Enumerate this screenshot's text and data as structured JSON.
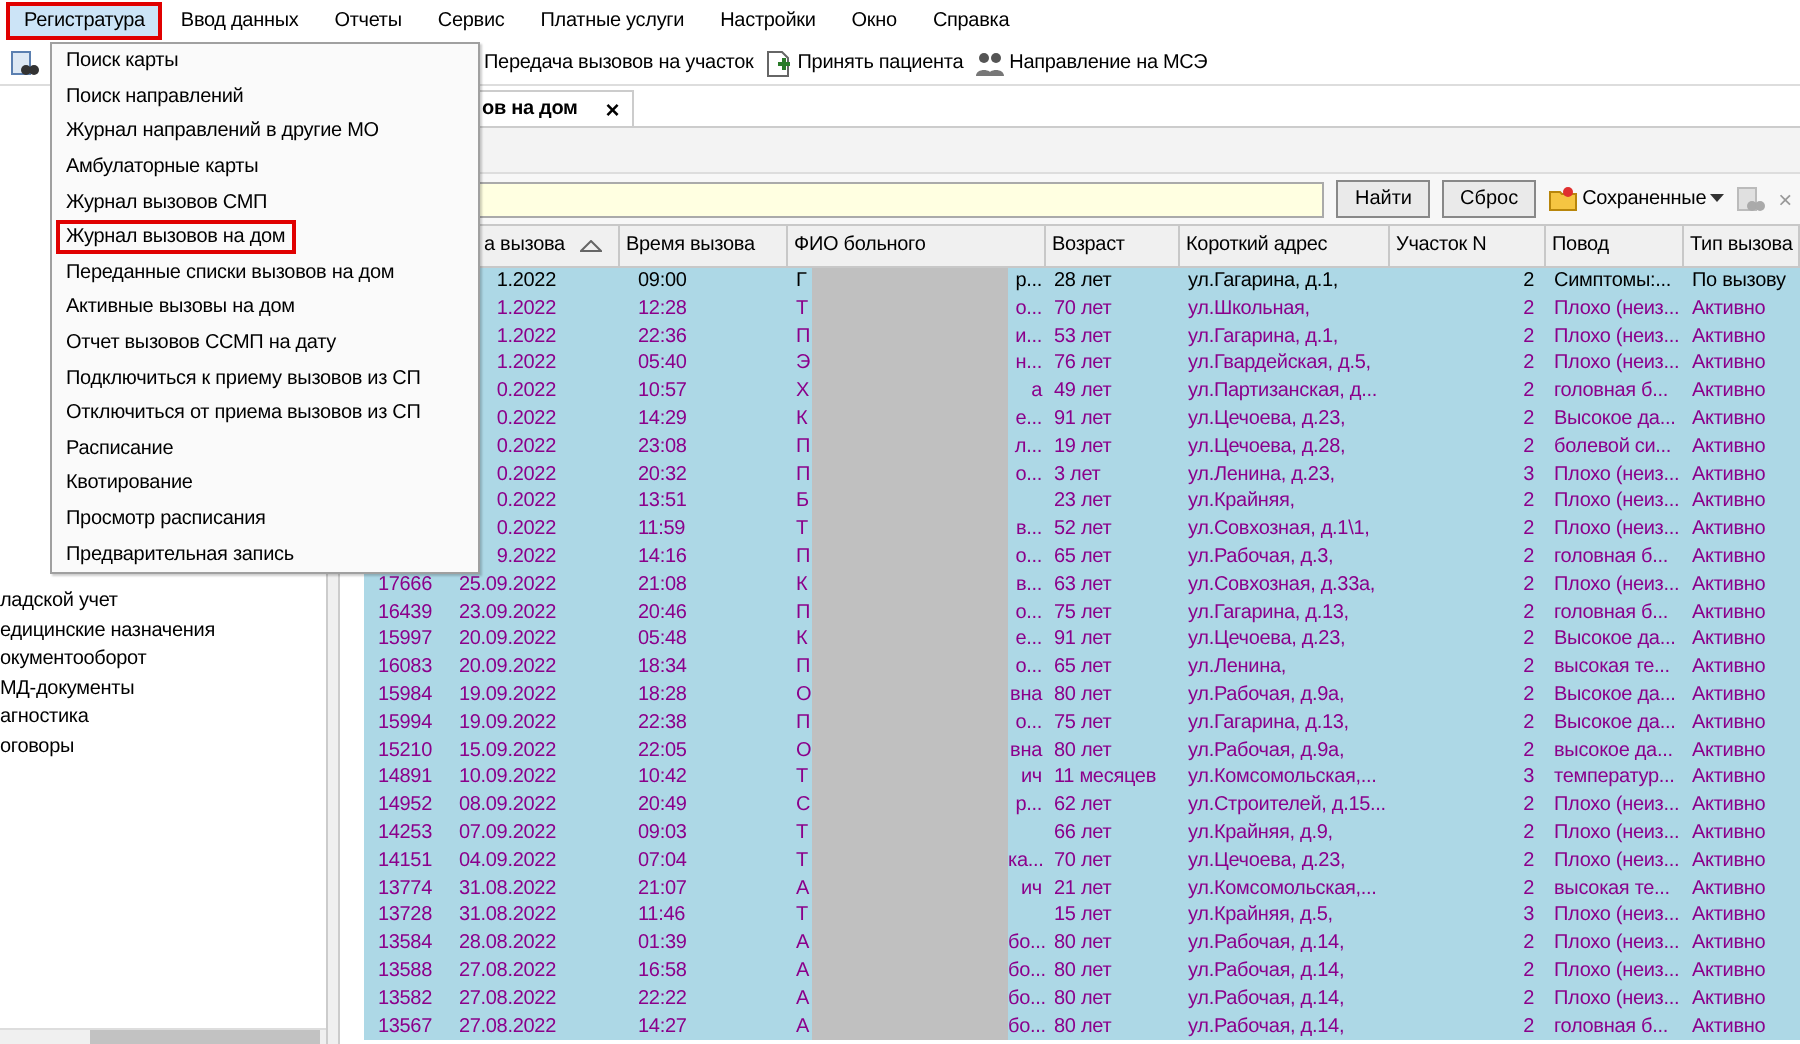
{
  "menu_bar": [
    {
      "label": "Регистратура",
      "open": true,
      "highlighted": true
    },
    {
      "label": "Ввод данных",
      "open": false,
      "highlighted": false
    },
    {
      "label": "Отчеты",
      "open": false,
      "highlighted": false
    },
    {
      "label": "Сервис",
      "open": false,
      "highlighted": false
    },
    {
      "label": "Платные услуги",
      "open": false,
      "highlighted": false
    },
    {
      "label": "Настройки",
      "open": false,
      "highlighted": false
    },
    {
      "label": "Окно",
      "open": false,
      "highlighted": false
    },
    {
      "label": "Справка",
      "open": false,
      "highlighted": false
    }
  ],
  "dropdown": [
    {
      "label": "Поиск карты",
      "highlighted": false
    },
    {
      "label": "Поиск направлений",
      "highlighted": false
    },
    {
      "label": "Журнал направлений в другие МО",
      "highlighted": false
    },
    {
      "label": "Амбулаторные карты",
      "highlighted": false
    },
    {
      "label": "Журнал вызовов СМП",
      "highlighted": false
    },
    {
      "label": "Журнал вызовов на дом",
      "highlighted": true
    },
    {
      "label": "Переданные списки вызовов на дом",
      "highlighted": false
    },
    {
      "label": "Активные вызовы на дом",
      "highlighted": false
    },
    {
      "label": "Отчет вызовов ССМП на дату",
      "highlighted": false
    },
    {
      "label": "Подключиться к приему вызовов из СП",
      "highlighted": false
    },
    {
      "label": "Отключиться от приема вызовов из СП",
      "highlighted": false
    },
    {
      "label": "Расписание",
      "highlighted": false
    },
    {
      "label": "Квотирование",
      "highlighted": false
    },
    {
      "label": "Просмотр расписания",
      "highlighted": false
    },
    {
      "label": "Предварительная запись",
      "highlighted": false
    }
  ],
  "toolbar": [
    {
      "label": "Передача вызовов на участок",
      "kind": "text"
    },
    {
      "label": "Принять пациента",
      "kind": "document"
    },
    {
      "label": "Направление на МСЭ",
      "kind": "people"
    }
  ],
  "tab": {
    "label": "ов на дом",
    "selected": true,
    "close": "×"
  },
  "filter": {
    "buttons": [
      "Найти",
      "Сброс"
    ],
    "saved": "Сохраненные",
    "close": "×"
  },
  "tree": [
    "ладской учет",
    "едицинские назначения",
    "окументооборот",
    "МД-документы",
    "агностика",
    "оговоры"
  ],
  "table": {
    "columns": [
      {
        "label": "а вызова",
        "sorted": true
      },
      {
        "label": "Время вызова",
        "sorted": false
      },
      {
        "label": "ФИО больного",
        "sorted": false
      },
      {
        "label": "Возраст",
        "sorted": false
      },
      {
        "label": "Короткий адрес",
        "sorted": false
      },
      {
        "label": "Участок N",
        "sorted": false
      },
      {
        "label": "Повод",
        "sorted": false
      },
      {
        "label": "Тип вызова",
        "sorted": false
      }
    ],
    "rows": [
      {
        "date": "1.2022",
        "time": "09:00",
        "name_initial": "Г",
        "name_tail": "р...",
        "age": "28 лет",
        "address": "ул.Гагарина, д.1,",
        "district": "2",
        "reason": "Симптомы:...",
        "type": "По вызову",
        "color": "#000000"
      },
      {
        "date": "1.2022",
        "time": "12:28",
        "name_initial": "Т",
        "name_tail": "о...",
        "age": "70 лет",
        "address": "ул.Школьная,",
        "district": "2",
        "reason": "Плохо (неиз...",
        "type": "Активно",
        "color": "#8b008b"
      },
      {
        "date": "1.2022",
        "time": "22:36",
        "name_initial": "П",
        "name_tail": "и...",
        "age": "53 лет",
        "address": "ул.Гагарина, д.1,",
        "district": "2",
        "reason": "Плохо (неиз...",
        "type": "Активно",
        "color": "#8b008b"
      },
      {
        "date": "1.2022",
        "time": "05:40",
        "name_initial": "Э",
        "name_tail": "н...",
        "age": "76 лет",
        "address": "ул.Гвардейская, д.5,",
        "district": "2",
        "reason": "Плохо (неиз...",
        "type": "Активно",
        "color": "#8b008b"
      },
      {
        "date": "0.2022",
        "time": "10:57",
        "name_initial": "Х",
        "name_tail": "а",
        "age": "49 лет",
        "address": "ул.Партизанская, д...",
        "district": "2",
        "reason": "головная б...",
        "type": "Активно",
        "color": "#8b008b"
      },
      {
        "date": "0.2022",
        "time": "14:29",
        "name_initial": "К",
        "name_tail": "е...",
        "age": "91 лет",
        "address": "ул.Цечоева, д.23,",
        "district": "2",
        "reason": "Высокое да...",
        "type": "Активно",
        "color": "#8b008b"
      },
      {
        "date": "0.2022",
        "time": "23:08",
        "name_initial": "П",
        "name_tail": "л...",
        "age": "19 лет",
        "address": "ул.Цечоева, д.28,",
        "district": "2",
        "reason": "болевой си...",
        "type": "Активно",
        "color": "#8b008b"
      },
      {
        "date": "0.2022",
        "time": "20:32",
        "name_initial": "П",
        "name_tail": "о...",
        "age": "3 лет",
        "address": "ул.Ленина, д.23,",
        "district": "3",
        "reason": "Плохо (неиз...",
        "type": "Активно",
        "color": "#8b008b"
      },
      {
        "date": "0.2022",
        "time": "13:51",
        "name_initial": "Б",
        "age": "23 лет",
        "address": "ул.Крайняя,",
        "district": "2",
        "reason": "Плохо (неиз...",
        "type": "Активно",
        "color": "#8b008b"
      },
      {
        "date": "0.2022",
        "time": "11:59",
        "name_initial": "Т",
        "name_tail": "в...",
        "age": "52 лет",
        "address": "ул.Совхозная, д.1\\1,",
        "district": "2",
        "reason": "Плохо (неиз...",
        "type": "Активно",
        "color": "#8b008b"
      },
      {
        "date": "9.2022",
        "time": "14:16",
        "name_initial": "П",
        "name_tail": "о...",
        "age": "65 лет",
        "address": "ул.Рабочая, д.3,",
        "district": "2",
        "reason": "головная б...",
        "type": "Активно",
        "color": "#8b008b"
      },
      {
        "id": "17666",
        "date": "25.09.2022",
        "time": "21:08",
        "name_initial": "К",
        "name_tail": "в...",
        "age": "63 лет",
        "address": "ул.Совхозная, д.33а,",
        "district": "2",
        "reason": "Плохо (неиз...",
        "type": "Активно",
        "color": "#8b008b"
      },
      {
        "id": "16439",
        "date": "23.09.2022",
        "time": "20:46",
        "name_initial": "П",
        "name_tail": "о...",
        "age": "75 лет",
        "address": "ул.Гагарина, д.13,",
        "district": "2",
        "reason": "головная б...",
        "type": "Активно",
        "color": "#8b008b"
      },
      {
        "id": "15997",
        "date": "20.09.2022",
        "time": "05:48",
        "name_initial": "К",
        "name_tail": "е...",
        "age": "91 лет",
        "address": "ул.Цечоева, д.23,",
        "district": "2",
        "reason": "Высокое да...",
        "type": "Активно",
        "color": "#8b008b"
      },
      {
        "id": "16083",
        "date": "20.09.2022",
        "time": "18:34",
        "name_initial": "П",
        "name_tail": "о...",
        "age": "65 лет",
        "address": "ул.Ленина,",
        "district": "2",
        "reason": "высокая те...",
        "type": "Активно",
        "color": "#8b008b"
      },
      {
        "id": "15984",
        "date": "19.09.2022",
        "time": "18:28",
        "name_initial": "О",
        "name_tail": "вна",
        "age": "80 лет",
        "address": "ул.Рабочая, д.9а,",
        "district": "2",
        "reason": "Высокое да...",
        "type": "Активно",
        "color": "#8b008b"
      },
      {
        "id": "15994",
        "date": "19.09.2022",
        "time": "22:38",
        "name_initial": "П",
        "name_tail": "о...",
        "age": "75 лет",
        "address": "ул.Гагарина, д.13,",
        "district": "2",
        "reason": "Высокое да...",
        "type": "Активно",
        "color": "#8b008b"
      },
      {
        "id": "15210",
        "date": "15.09.2022",
        "time": "22:05",
        "name_initial": "О",
        "name_tail": "вна",
        "age": "80 лет",
        "address": "ул.Рабочая, д.9а,",
        "district": "2",
        "reason": "высокое да...",
        "type": "Активно",
        "color": "#8b008b"
      },
      {
        "id": "14891",
        "date": "10.09.2022",
        "time": "10:42",
        "name_initial": "Т",
        "name_tail": "ич",
        "age": "11 месяцев",
        "address": "ул.Комсомольская,...",
        "district": "3",
        "reason": "температур...",
        "type": "Активно",
        "color": "#8b008b"
      },
      {
        "id": "14952",
        "date": "08.09.2022",
        "time": "20:49",
        "name_initial": "С",
        "name_tail": "р...",
        "age": "62 лет",
        "address": "ул.Строителей, д.15...",
        "district": "2",
        "reason": "Плохо (неиз...",
        "type": "Активно",
        "color": "#8b008b"
      },
      {
        "id": "14253",
        "date": "07.09.2022",
        "time": "09:03",
        "name_initial": "Т",
        "age": "66 лет",
        "address": "ул.Крайняя, д.9,",
        "district": "2",
        "reason": "Плохо (неиз...",
        "type": "Активно",
        "color": "#8b008b"
      },
      {
        "id": "14151",
        "date": "04.09.2022",
        "time": "07:04",
        "name_initial": "Т",
        "name_tail": "ка...",
        "age": "70 лет",
        "address": "ул.Цечоева, д.23,",
        "district": "2",
        "reason": "Плохо (неиз...",
        "type": "Активно",
        "color": "#8b008b"
      },
      {
        "id": "13774",
        "date": "31.08.2022",
        "time": "21:07",
        "name_initial": "А",
        "name_tail": "ич",
        "age": "21 лет",
        "address": "ул.Комсомольская,...",
        "district": "2",
        "reason": "высокая те...",
        "type": "Активно",
        "color": "#8b008b"
      },
      {
        "id": "13728",
        "date": "31.08.2022",
        "time": "11:46",
        "name_initial": "Т",
        "age": "15 лет",
        "address": "ул.Крайняя, д.5,",
        "district": "3",
        "reason": "Плохо (неиз...",
        "type": "Активно",
        "color": "#8b008b"
      },
      {
        "id": "13584",
        "date": "28.08.2022",
        "time": "01:39",
        "name_initial": "А",
        "name_tail": "бо...",
        "age": "80 лет",
        "address": "ул.Рабочая, д.14,",
        "district": "2",
        "reason": "Плохо (неиз...",
        "type": "Активно",
        "color": "#8b008b"
      },
      {
        "id": "13588",
        "date": "27.08.2022",
        "time": "16:58",
        "name_initial": "А",
        "name_tail": "бо...",
        "age": "80 лет",
        "address": "ул.Рабочая, д.14,",
        "district": "2",
        "reason": "Плохо (неиз...",
        "type": "Активно",
        "color": "#8b008b"
      },
      {
        "id": "13582",
        "date": "27.08.2022",
        "time": "22:22",
        "name_initial": "А",
        "name_tail": "бо...",
        "age": "80 лет",
        "address": "ул.Рабочая, д.14,",
        "district": "2",
        "reason": "Плохо (неиз...",
        "type": "Активно",
        "color": "#8b008b"
      },
      {
        "id": "13567",
        "date": "27.08.2022",
        "time": "14:27",
        "name_initial": "А",
        "name_tail": "бо...",
        "age": "80 лет",
        "address": "ул.Рабочая, д.14,",
        "district": "2",
        "reason": "головная б...",
        "type": "Активно",
        "color": "#8b008b"
      }
    ]
  }
}
